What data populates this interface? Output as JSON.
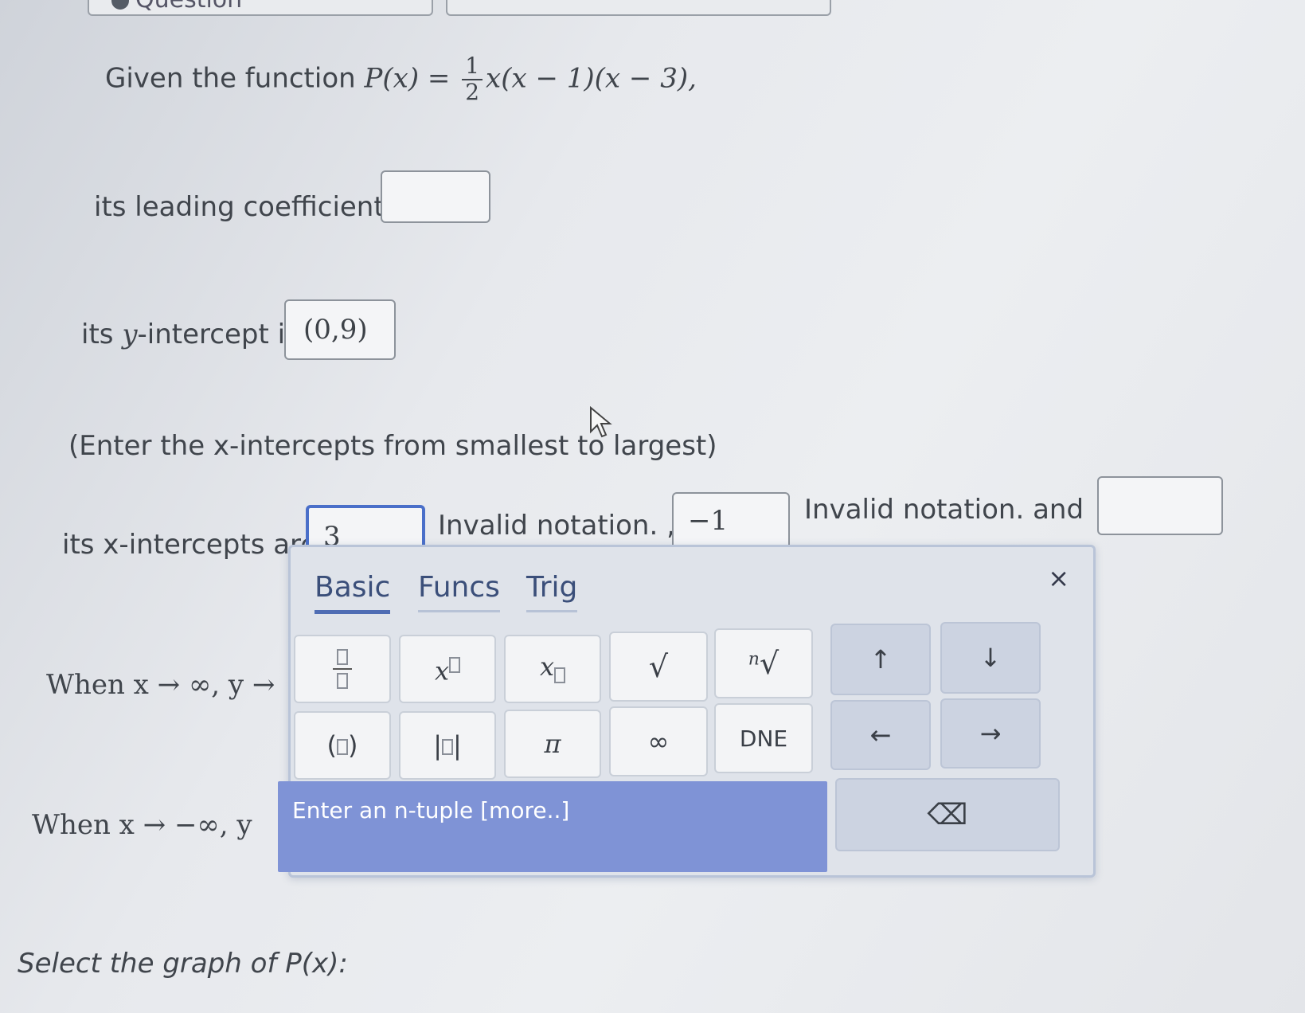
{
  "question_header": "Question",
  "problem": {
    "given_prefix": "Given the function",
    "function_lhs": "P(x) =",
    "frac_num": "1",
    "frac_den": "2",
    "function_rhs": "x(x − 1)(x − 3),",
    "leading_coefficient_label": "its leading coefficient is",
    "leading_coefficient_value": "",
    "y_intercept_label_pre": "its",
    "y_intercept_var": "y",
    "y_intercept_label_post": "-intercept is",
    "y_intercept_value": "(0,9)",
    "instruction": "(Enter the x-intercepts from smallest to largest)",
    "x_intercepts_label": "its x-intercepts are",
    "x_int_1_value": "3",
    "invalid_1": "Invalid notation. ,",
    "x_int_2_value": "−1",
    "invalid_2": "Invalid notation. and",
    "x_int_3_value": "",
    "when_pos_inf": "When x → ∞, y →",
    "when_neg_inf": "When x → −∞, y",
    "select_graph": "Select the graph of P(x):"
  },
  "keypad": {
    "tabs": [
      "Basic",
      "Funcs",
      "Trig"
    ],
    "selected_tab": "Basic",
    "close": "×",
    "keys": {
      "power_x": "x",
      "subscript_x": "x",
      "sqrt": "√",
      "nth_root_n": "n",
      "nth_root": "√",
      "up": "↑",
      "down": "↓",
      "paren_open": "(",
      "paren_close": ")",
      "abs_left": "|",
      "abs_right": "|",
      "pi": "π",
      "infinity": "∞",
      "dne": "DNE",
      "left": "←",
      "right": "→",
      "ntuple": "Enter an n-tuple [more..]",
      "backspace": "⌫"
    }
  }
}
